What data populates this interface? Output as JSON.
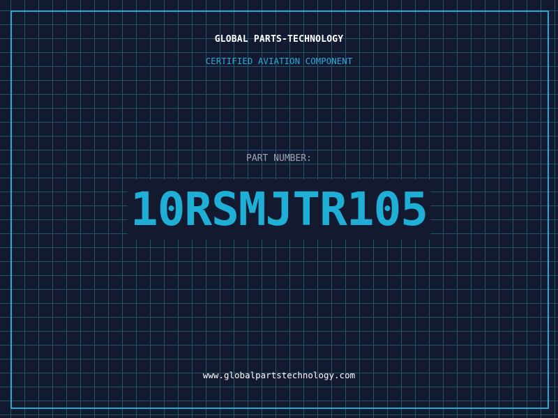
{
  "card": {
    "brand": "GLOBAL PARTS-TECHNOLOGY",
    "tagline": "CERTIFIED AVIATION COMPONENT",
    "part_label": "PART NUMBER:",
    "part_number": "10RSMJTR105",
    "website": "www.globalpartstechnology.com"
  },
  "colors": {
    "background": "#131a30",
    "grid": "#22556a",
    "accent": "#1eaed6",
    "label": "#9aa4b2",
    "text": "#ffffff"
  }
}
